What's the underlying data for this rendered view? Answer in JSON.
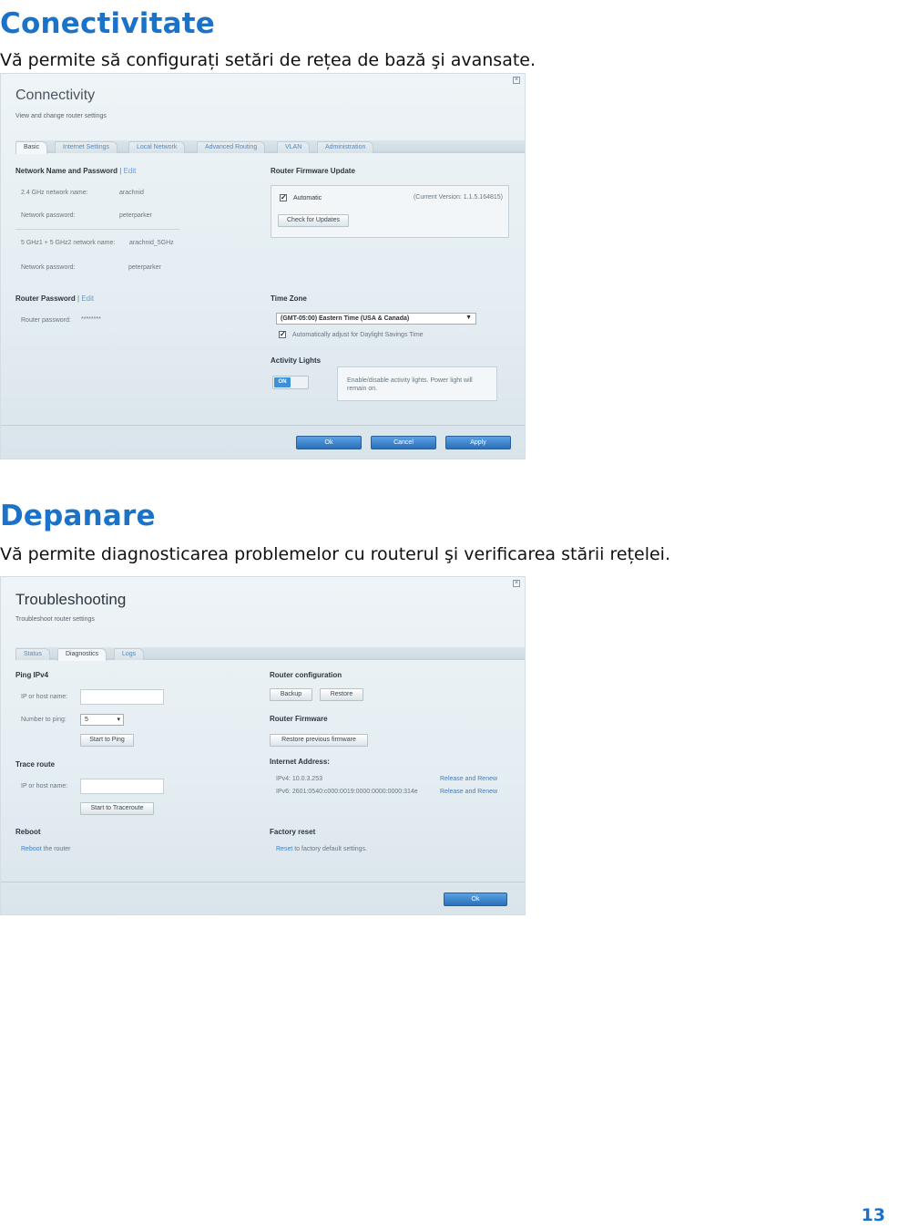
{
  "section1": {
    "title": "Conectivitate",
    "desc": "Vă permite să configurați setări de rețea de bază şi avansate."
  },
  "connectivity": {
    "title": "Connectivity",
    "subtitle": "View and change router settings",
    "close_glyph": "×",
    "tabs": [
      "Basic",
      "Internet Settings",
      "Local Network",
      "Advanced Routing",
      "VLAN",
      "Administration"
    ],
    "network": {
      "heading": "Network Name and Password",
      "sep": "|",
      "edit": "Edit",
      "ssid24_label": "2.4 GHz network name:",
      "ssid24_value": "arachnid",
      "pw1_label": "Network password:",
      "pw1_value": "peterparker",
      "ssid5_label": "5 GHz1 + 5 GHz2 network name:",
      "ssid5_value": "arachnid_5GHz",
      "pw2_label": "Network password:",
      "pw2_value": "peterparker"
    },
    "router_password": {
      "heading": "Router Password",
      "sep": "|",
      "edit": "Edit",
      "label": "Router password:",
      "value": "********"
    },
    "firmware": {
      "heading": "Router Firmware Update",
      "auto_label": "Automatic",
      "version": "(Current Version: 1.1.5.164815)",
      "check_button": "Check for Updates"
    },
    "timezone": {
      "heading": "Time Zone",
      "selected": "(GMT-05:00) Eastern Time (USA & Canada)",
      "dst_label": "Automatically adjust for Daylight Savings Time"
    },
    "activity": {
      "heading": "Activity Lights",
      "toggle": "ON",
      "note": "Enable/disable activity lights. Power light will remain on."
    },
    "buttons": {
      "ok": "Ok",
      "cancel": "Cancel",
      "apply": "Apply"
    }
  },
  "section2": {
    "title": "Depanare",
    "desc": "Vă permite diagnosticarea problemelor cu routerul şi verificarea stării rețelei."
  },
  "troubleshooting": {
    "title": "Troubleshooting",
    "subtitle": "Troubleshoot router settings",
    "close_glyph": "×",
    "tabs": [
      "Status",
      "Diagnostics",
      "Logs"
    ],
    "ping": {
      "heading": "Ping IPv4",
      "host_label": "IP or host name:",
      "count_label": "Number to ping:",
      "count_value": "5",
      "start_button": "Start to Ping"
    },
    "trace": {
      "heading": "Trace route",
      "host_label": "IP or host name:",
      "start_button": "Start to Traceroute"
    },
    "reboot": {
      "heading": "Reboot",
      "link": "Reboot",
      "text": " the router"
    },
    "config": {
      "heading": "Router configuration",
      "backup": "Backup",
      "restore": "Restore"
    },
    "firmware": {
      "heading": "Router Firmware",
      "restore_button": "Restore previous firmware"
    },
    "internet": {
      "heading": "Internet Address:",
      "ipv4": "IPv4: 10.0.3.253",
      "ipv6": "IPv6: 2601:0540:c000:0019:0000:0000:0000:314e",
      "release1": "Release and Renew",
      "release2": "Release and Renew"
    },
    "factory": {
      "heading": "Factory reset",
      "link": "Reset",
      "text": " to factory default settings."
    },
    "buttons": {
      "ok": "Ok"
    }
  },
  "page_number": "13"
}
